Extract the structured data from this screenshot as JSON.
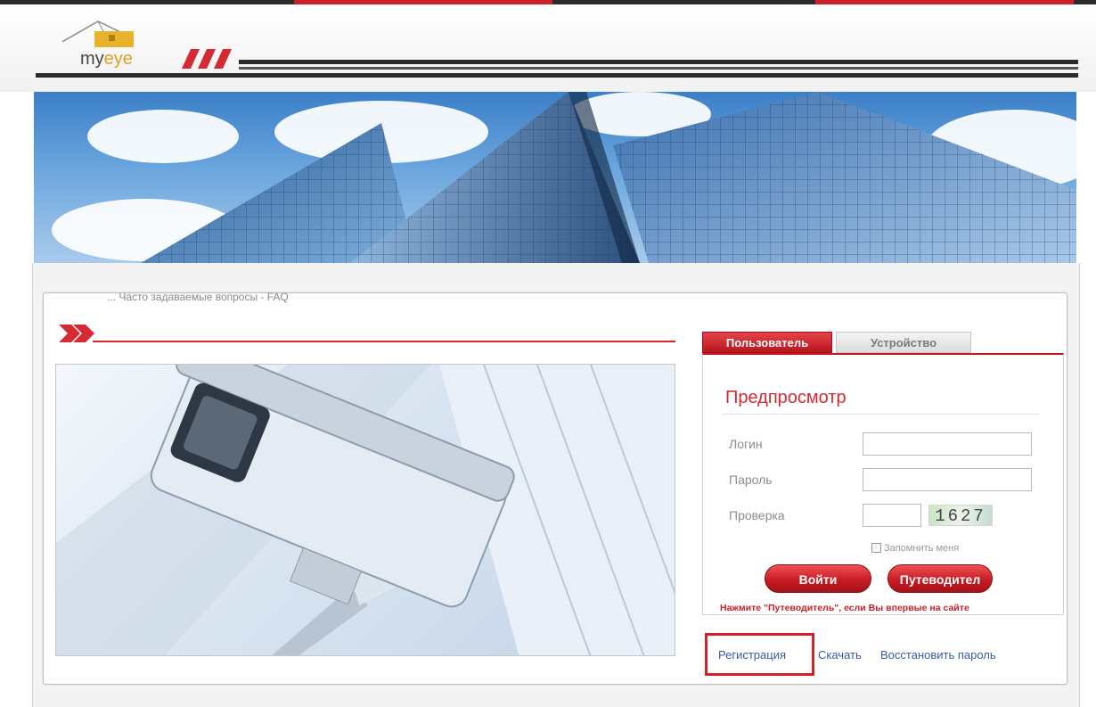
{
  "header": {
    "logo_text_prefix": "my",
    "logo_text_highlight": "eye",
    "colors": {
      "brand_red": "#d42a32",
      "bar_dark": "#2b2b2b"
    }
  },
  "section": {
    "faded_text": "... Часто задаваемые вопросы - FAQ"
  },
  "login": {
    "tabs": [
      {
        "label": "Пользователь",
        "active": true
      },
      {
        "label": "Устройство",
        "active": false
      }
    ],
    "title": "Предпросмотр",
    "fields": {
      "login_label": "Логин",
      "password_label": "Пароль",
      "check_label": "Проверка",
      "login_value": "",
      "password_value": "",
      "check_value": ""
    },
    "captcha": "1627",
    "remember_label": "Запомнить меня",
    "login_button": "Войти",
    "guide_button": "Путеводител",
    "hint": "Нажмите \"Путеводитель\", если Вы впервые на сайте"
  },
  "links": {
    "register": "Регистрация",
    "download": "Скачать",
    "recover": "Восстановить пароль"
  },
  "icons": [
    "logo-house-icon",
    "red-slashes-icon",
    "section-chevron-icon",
    "checkbox-icon"
  ]
}
